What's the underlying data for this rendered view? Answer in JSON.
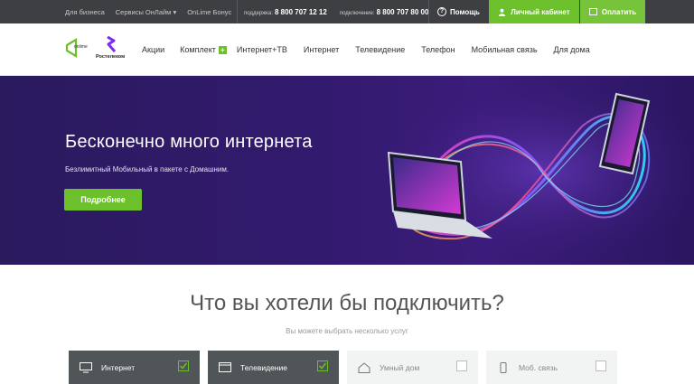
{
  "topbar": {
    "business": "Для бизнеса",
    "services": "Сервисы ОнЛайм",
    "bonus": "OnLime Бонус",
    "support_label": "поддержка:",
    "support_phone": "8 800 707 12 12",
    "connect_label": "подключение:",
    "connect_phone": "8 800 707 80 00",
    "help": "Помощь",
    "cabinet": "Личный кабинет",
    "pay": "Оплатить"
  },
  "header": {
    "logo_online": "onlime",
    "logo_rt": "Ростелеком",
    "nav": [
      {
        "label": "Акции"
      },
      {
        "label": "Комплект"
      },
      {
        "label": "Интернет+ТВ"
      },
      {
        "label": "Интернет"
      },
      {
        "label": "Телевидение"
      },
      {
        "label": "Телефон"
      },
      {
        "label": "Мобильная связь"
      },
      {
        "label": "Для дома"
      }
    ],
    "nav_plus": "+"
  },
  "hero": {
    "title": "Бесконечно много интернета",
    "subtitle": "Безлимитный Мобильный в пакете с Домашним.",
    "button": "Подробнее"
  },
  "section": {
    "title": "Что вы хотели бы подключить?",
    "subtitle": "Вы можете выбрать несколько услуг",
    "cards": [
      {
        "label": "Интернет",
        "icon": "monitor-icon",
        "checked": true
      },
      {
        "label": "Телевидение",
        "icon": "tv-icon",
        "checked": true
      },
      {
        "label": "Умный дом",
        "icon": "home-icon",
        "checked": false
      },
      {
        "label": "Моб. связь",
        "icon": "phone-icon",
        "checked": false
      }
    ]
  },
  "colors": {
    "accent_green": "#6cc02b",
    "topbar": "#3d3f42",
    "hero_bg": "#321a6e",
    "card_active": "#505558",
    "card_inactive": "#f2f3f3"
  }
}
